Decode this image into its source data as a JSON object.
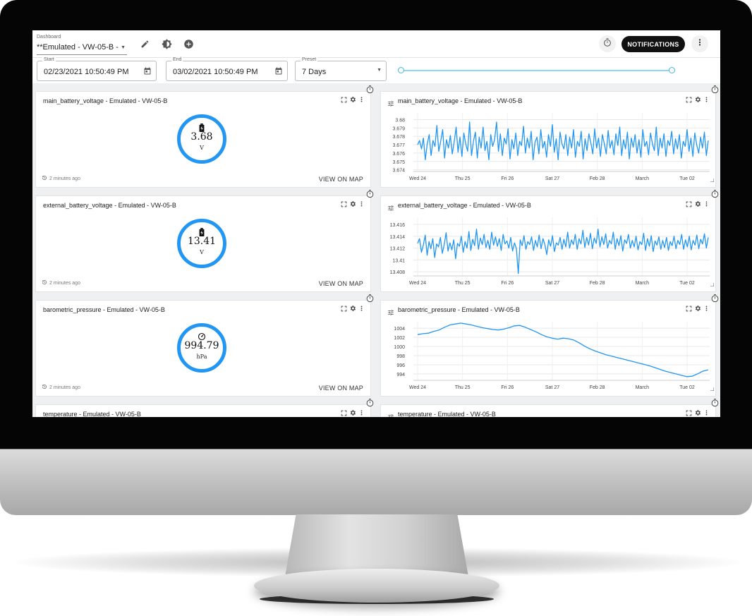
{
  "topbar": {
    "dashboard_label": "Dashboard",
    "dashboard_value": "**Emulated - VW-05-B - (",
    "notifications_label": "NOTIFICATIONS"
  },
  "datebar": {
    "start_label": "Start",
    "start_value": "02/23/2021 10:50:49 PM",
    "end_label": "End",
    "end_value": "03/02/2021 10:50:49 PM",
    "preset_label": "Preset",
    "preset_value": "7 Days",
    "range_slider_fraction": [
      0.0,
      1.0
    ]
  },
  "accent_color": "#2196f3",
  "gauges": [
    {
      "title": "main_battery_voltage - Emulated - VW-05-B",
      "value": "3.68",
      "unit": "V",
      "icon": "battery-icon",
      "updated": "2 minutes ago",
      "link": "VIEW ON MAP"
    },
    {
      "title": "external_battery_voltage - Emulated - VW-05-B",
      "value": "13.41",
      "unit": "V",
      "icon": "battery-icon",
      "updated": "2 minutes ago",
      "link": "VIEW ON MAP"
    },
    {
      "title": "barometric_pressure - Emulated - VW-05-B",
      "value": "994.79",
      "unit": "hPa",
      "icon": "gauge-icon",
      "updated": "2 minutes ago",
      "link": "VIEW ON MAP"
    },
    {
      "title": "temperature - Emulated - VW-05-B"
    }
  ],
  "charts_meta": [
    {
      "title": "main_battery_voltage - Emulated - VW-05-B"
    },
    {
      "title": "external_battery_voltage - Emulated - VW-05-B"
    },
    {
      "title": "barometric_pressure - Emulated - VW-05-B"
    },
    {
      "title": "temperature - Emulated - VW-05-B"
    }
  ],
  "chart_data": [
    {
      "type": "line",
      "title": "main_battery_voltage - Emulated - VW-05-B",
      "x_tick_labels": [
        "Wed 24",
        "Thu 25",
        "Fri 26",
        "Sat 27",
        "Feb 28",
        "March",
        "Tue 02"
      ],
      "y_tick_labels": [
        "3.68",
        "3.679",
        "3.678",
        "3.677",
        "3.676",
        "3.675",
        "3.674"
      ],
      "ylim": [
        3.6738,
        3.6808
      ],
      "grid": true,
      "values": [
        3.677,
        3.6775,
        3.6765,
        3.6778,
        3.6752,
        3.6771,
        3.6782,
        3.6757,
        3.6775,
        3.6768,
        3.6793,
        3.6762,
        3.6774,
        3.6788,
        3.6754,
        3.6776,
        3.6766,
        3.6781,
        3.6759,
        3.6773,
        3.6791,
        3.6761,
        3.6779,
        3.6756,
        3.6784,
        3.6771,
        3.6762,
        3.6797,
        3.6757,
        3.6774,
        3.6785,
        3.6754,
        3.6779,
        3.6766,
        3.6791,
        3.6763,
        3.6774,
        3.6752,
        3.6782,
        3.6768,
        3.6776,
        3.6797,
        3.6762,
        3.6783,
        3.6757,
        3.6778,
        3.6771,
        3.6789,
        3.6753,
        3.6776,
        3.6765,
        3.6784,
        3.6757,
        3.6774,
        3.6769,
        3.6792,
        3.676,
        3.6778,
        3.6766,
        3.6786,
        3.6752,
        3.6773,
        3.6779,
        3.6759,
        3.6788,
        3.6766,
        3.6774,
        3.6755,
        3.6782,
        3.6768,
        3.6794,
        3.6761,
        3.6777,
        3.6752,
        3.6785,
        3.6771,
        3.6765,
        3.6782,
        3.6757,
        3.6779,
        3.6766,
        3.6788,
        3.6755,
        3.6774,
        3.6768,
        3.6786,
        3.6753,
        3.6777,
        3.6763,
        3.6783,
        3.6772,
        3.6759,
        3.6789,
        3.6766,
        3.6778,
        3.6756,
        3.6782,
        3.6771,
        3.6759,
        3.6787,
        3.6766,
        3.6775,
        3.6758,
        3.6783,
        3.6769,
        3.6791,
        3.6757,
        3.6776,
        3.6765,
        3.6785,
        3.6753,
        3.6778,
        3.6767,
        3.6782,
        3.676,
        3.6776,
        3.6755,
        3.6788,
        3.6768,
        3.6774,
        3.6758,
        3.6784,
        3.6771,
        3.6763,
        3.6791,
        3.6757,
        3.6778,
        3.6766,
        3.6783,
        3.6756,
        3.6775,
        3.6769,
        3.6786,
        3.6759,
        3.6777,
        3.6765,
        3.6782,
        3.6754,
        3.6774,
        3.6768,
        3.6788,
        3.6762,
        3.6778,
        3.6756,
        3.6784,
        3.677,
        3.676,
        3.6779,
        3.6766,
        3.6785,
        3.6757,
        3.6775
      ]
    },
    {
      "type": "line",
      "title": "external_battery_voltage - Emulated - VW-05-B",
      "x_tick_labels": [
        "Wed 24",
        "Thu 25",
        "Fri 26",
        "Sat 27",
        "Feb 28",
        "March",
        "Tue 02"
      ],
      "y_tick_labels": [
        "13.416",
        "13.414",
        "13.412",
        "13.41",
        "13.408"
      ],
      "ylim": [
        13.4073,
        13.4172
      ],
      "grid": true,
      "values": [
        13.4128,
        13.4136,
        13.4113,
        13.4125,
        13.4142,
        13.4108,
        13.4131,
        13.4119,
        13.4136,
        13.4104,
        13.4127,
        13.4122,
        13.4138,
        13.4111,
        13.4126,
        13.4146,
        13.4115,
        13.4129,
        13.4117,
        13.4134,
        13.4102,
        13.4128,
        13.4123,
        13.414,
        13.4113,
        13.4131,
        13.412,
        13.4148,
        13.4116,
        13.4135,
        13.4124,
        13.4152,
        13.4118,
        13.4137,
        13.4126,
        13.4143,
        13.4121,
        13.4133,
        13.4118,
        13.4147,
        13.4125,
        13.4139,
        13.4123,
        13.4136,
        13.4116,
        13.4143,
        13.4127,
        13.4132,
        13.412,
        13.4138,
        13.4115,
        13.4129,
        13.4119,
        13.4077,
        13.4134,
        13.4124,
        13.4141,
        13.4118,
        13.4131,
        13.4126,
        13.4139,
        13.4116,
        13.4133,
        13.4122,
        13.4142,
        13.4119,
        13.4136,
        13.4126,
        13.4109,
        13.4134,
        13.4123,
        13.4141,
        13.4114,
        13.4129,
        13.4125,
        13.4138,
        13.4118,
        13.4135,
        13.4122,
        13.4147,
        13.412,
        13.4134,
        13.4126,
        13.4143,
        13.4118,
        13.4136,
        13.4127,
        13.415,
        13.4121,
        13.4138,
        13.4125,
        13.4145,
        13.4119,
        13.4137,
        13.4128,
        13.4152,
        13.4122,
        13.4139,
        13.4126,
        13.4144,
        13.412,
        13.4133,
        13.4127,
        13.4147,
        13.4118,
        13.4136,
        13.4124,
        13.4141,
        13.4115,
        13.4134,
        13.4128,
        13.4143,
        13.412,
        13.4133,
        13.4122,
        13.414,
        13.4117,
        13.4131,
        13.4126,
        13.4145,
        13.4116,
        13.4136,
        13.4123,
        13.4141,
        13.4114,
        13.4132,
        13.4125,
        13.4139,
        13.4118,
        13.4133,
        13.4121,
        13.4138,
        13.4116,
        13.4131,
        13.4124,
        13.414,
        13.4119,
        13.4133,
        13.4126,
        13.4143,
        13.4118,
        13.4134,
        13.4122,
        13.414,
        13.4117,
        13.4133,
        13.4125,
        13.4142,
        13.4119,
        13.4135,
        13.4127,
        13.4144,
        13.412,
        13.4138
      ]
    },
    {
      "type": "line",
      "title": "barometric_pressure - Emulated - VW-05-B",
      "x_tick_labels": [
        "Wed 24",
        "Thu 25",
        "Fri 26",
        "Sat 27",
        "Feb 28",
        "March",
        "Tue 02"
      ],
      "y_tick_labels": [
        "1004",
        "1002",
        "1000",
        "998",
        "996",
        "994"
      ],
      "ylim": [
        992.6,
        1005.4
      ],
      "grid": true,
      "values": [
        1002.6,
        1002.8,
        1002.9,
        1003.3,
        1003.6,
        1004.2,
        1004.7,
        1004.9,
        1005.1,
        1004.9,
        1004.7,
        1004.4,
        1004.1,
        1003.9,
        1003.7,
        1003.6,
        1003.8,
        1004.1,
        1004.5,
        1004.6,
        1004.2,
        1003.7,
        1003.2,
        1002.6,
        1002.1,
        1001.8,
        1001.6,
        1001.8,
        1001.7,
        1001.4,
        1000.8,
        1000.1,
        999.5,
        999.0,
        998.6,
        998.2,
        997.9,
        997.6,
        997.3,
        997.0,
        996.7,
        996.4,
        996.1,
        995.8,
        995.4,
        995.0,
        994.6,
        994.3,
        994.0,
        993.7,
        993.4,
        993.5,
        994.0,
        994.6,
        994.9
      ]
    },
    {
      "type": "line",
      "title": "temperature - Emulated - VW-05-B",
      "values": []
    }
  ]
}
